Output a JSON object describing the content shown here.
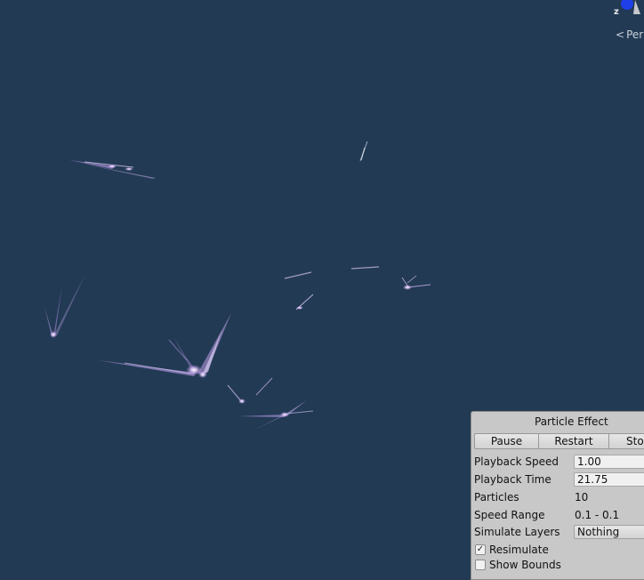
{
  "scene": {
    "gizmo_axis_label": "z",
    "projection_label": "Per"
  },
  "colors": {
    "scene_background": "#223a54",
    "particle_glow": "#f0e4ff",
    "particle_trail": "#c9a6f2",
    "panel_background": "#c8c8c8"
  },
  "particle_effect": {
    "title": "Particle Effect",
    "buttons": {
      "pause": "Pause",
      "restart": "Restart",
      "stop": "Sto"
    },
    "playback_speed": {
      "label": "Playback Speed",
      "value": "1.00"
    },
    "playback_time": {
      "label": "Playback Time",
      "value": "21.75"
    },
    "particles": {
      "label": "Particles",
      "value": "10"
    },
    "speed_range": {
      "label": "Speed Range",
      "value": "0.1 - 0.1"
    },
    "simulate_layers": {
      "label": "Simulate Layers",
      "value": "Nothing"
    },
    "resimulate": {
      "label": "Resimulate",
      "checked": true,
      "mark": "✓"
    },
    "show_bounds": {
      "label": "Show Bounds",
      "checked": false,
      "mark": ""
    }
  }
}
